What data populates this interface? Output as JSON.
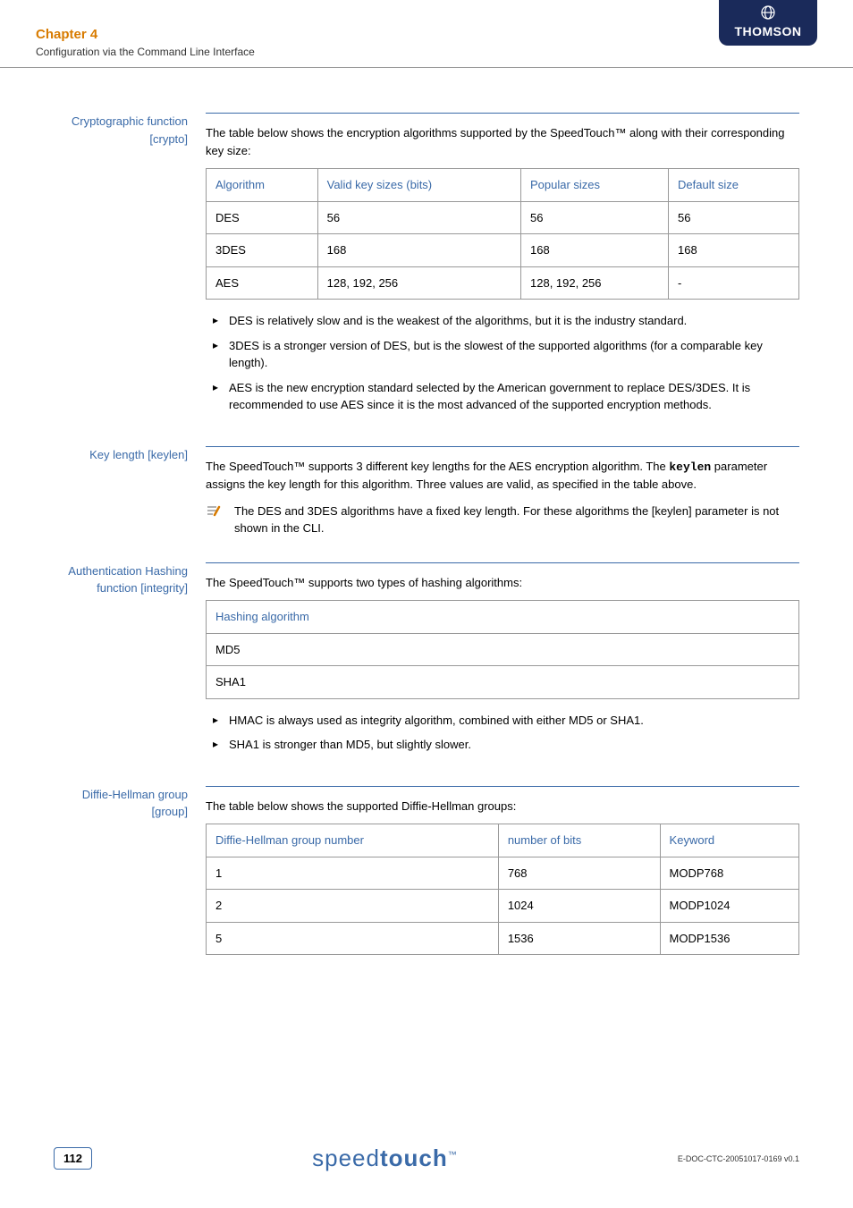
{
  "header": {
    "chapter": "Chapter 4",
    "subtitle": "Configuration via the Command Line Interface",
    "brand": "THOMSON"
  },
  "sections": {
    "crypto": {
      "label_line1": "Cryptographic function",
      "label_line2": "[crypto]",
      "intro": "The table below shows the encryption algorithms supported by the SpeedTouch™ along with their corresponding key size:",
      "table": {
        "headers": [
          "Algorithm",
          "Valid key sizes (bits)",
          "Popular sizes",
          "Default size"
        ],
        "rows": [
          [
            "DES",
            "56",
            "56",
            "56"
          ],
          [
            "3DES",
            "168",
            "168",
            "168"
          ],
          [
            "AES",
            "128, 192, 256",
            "128, 192, 256",
            "-"
          ]
        ]
      },
      "bullets": [
        "DES is relatively slow and is the weakest of the algorithms, but it is the industry standard.",
        "3DES is a stronger version of DES, but is the slowest of the supported algorithms (for a comparable key length).",
        "AES is the new encryption standard selected by the American government to replace DES/3DES. It is recommended to use AES since it is the most advanced of the supported encryption methods."
      ]
    },
    "keylen": {
      "label": "Key length [keylen]",
      "p1_a": "The SpeedTouch™ supports 3 different key lengths for the AES encryption algorithm. The ",
      "p1_k": "keylen",
      "p1_b": " parameter assigns the key length for this algorithm. Three values are valid, as specified in the table above.",
      "note": "The DES and 3DES algorithms have a fixed key length. For these algorithms the [keylen] parameter is not shown in the CLI."
    },
    "integrity": {
      "label_line1": "Authentication Hashing",
      "label_line2": "function [integrity]",
      "intro": "The SpeedTouch™ supports two types of hashing algorithms:",
      "table": {
        "header": "Hashing algorithm",
        "rows": [
          "MD5",
          "SHA1"
        ]
      },
      "bullets": [
        "HMAC is always used as integrity algorithm, combined with either MD5 or SHA1.",
        "SHA1 is stronger than MD5, but slightly slower."
      ]
    },
    "group": {
      "label_line1": "Diffie-Hellman group",
      "label_line2": "[group]",
      "intro": "The table below shows the supported Diffie-Hellman groups:",
      "table": {
        "headers": [
          "Diffie-Hellman group number",
          "number of bits",
          "Keyword"
        ],
        "rows": [
          [
            "1",
            "768",
            "MODP768"
          ],
          [
            "2",
            "1024",
            "MODP1024"
          ],
          [
            "5",
            "1536",
            "MODP1536"
          ]
        ]
      }
    }
  },
  "footer": {
    "page": "112",
    "logo_light": "speed",
    "logo_bold": "touch",
    "logo_tm": "™",
    "docid": "E-DOC-CTC-20051017-0169 v0.1"
  }
}
